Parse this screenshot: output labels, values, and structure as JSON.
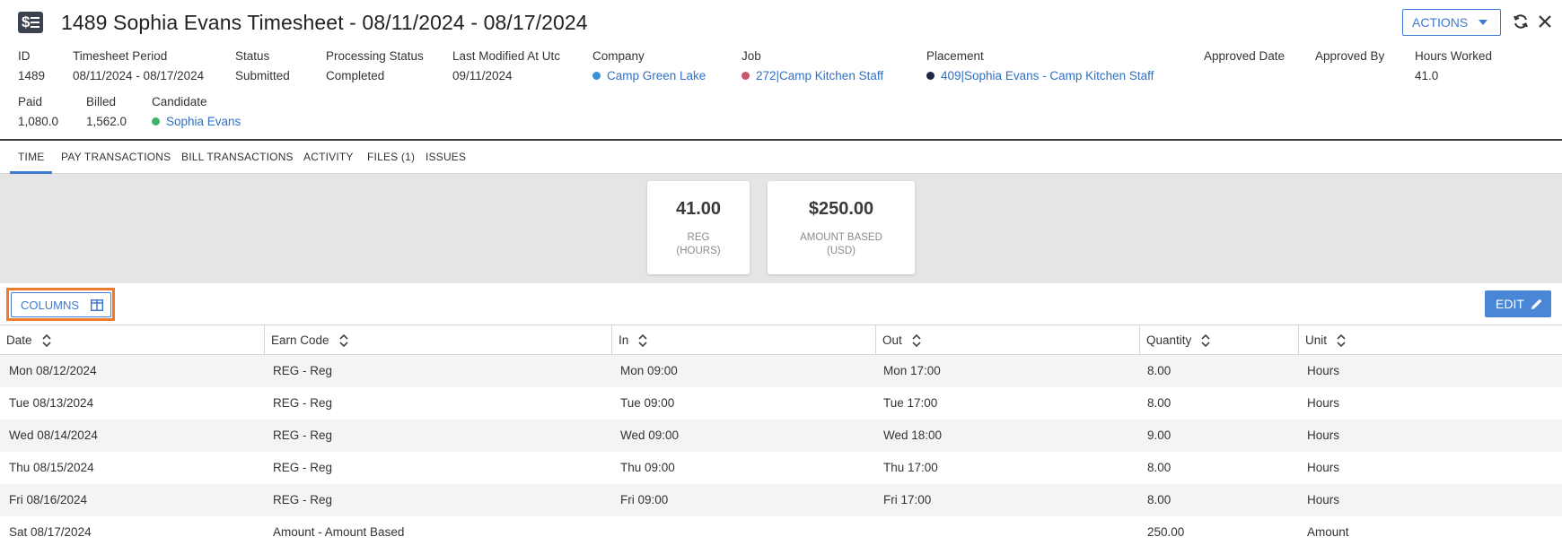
{
  "header": {
    "title": "1489  Sophia Evans Timesheet - 08/11/2024 - 08/17/2024",
    "actions_label": "ACTIONS",
    "fields": {
      "id": {
        "label": "ID",
        "value": "1489"
      },
      "period": {
        "label": "Timesheet Period",
        "value": "08/11/2024 - 08/17/2024"
      },
      "status": {
        "label": "Status",
        "value": "Submitted"
      },
      "processing": {
        "label": "Processing Status",
        "value": "Completed"
      },
      "modified": {
        "label": "Last Modified At Utc",
        "value": "09/11/2024"
      },
      "company": {
        "label": "Company",
        "value": "Camp Green Lake",
        "dot_color": "#3b8fd6"
      },
      "job": {
        "label": "Job",
        "value": "272|Camp Kitchen Staff",
        "dot_color": "#c75a6a"
      },
      "placement": {
        "label": "Placement",
        "value": "409|Sophia Evans - Camp Kitchen Staff",
        "dot_color": "#1e2a44"
      },
      "approved_date": {
        "label": "Approved Date",
        "value": ""
      },
      "approved_by": {
        "label": "Approved By",
        "value": ""
      },
      "hours_worked": {
        "label": "Hours Worked",
        "value": "41.0"
      },
      "paid": {
        "label": "Paid",
        "value": "1,080.0"
      },
      "billed": {
        "label": "Billed",
        "value": "1,562.0"
      },
      "candidate": {
        "label": "Candidate",
        "value": "Sophia Evans",
        "dot_color": "#3fb56a"
      }
    }
  },
  "tabs": [
    "TIME",
    "PAY TRANSACTIONS",
    "BILL TRANSACTIONS",
    "ACTIVITY",
    "FILES (1)",
    "ISSUES"
  ],
  "summary": [
    {
      "value": "41.00",
      "label_line1": "REG",
      "label_line2": "(HOURS)"
    },
    {
      "value": "$250.00",
      "label_line1": "AMOUNT BASED",
      "label_line2": "(USD)"
    }
  ],
  "toolbar": {
    "columns_label": "COLUMNS",
    "edit_label": "EDIT"
  },
  "table": {
    "headers": [
      "Date",
      "Earn Code",
      "In",
      "Out",
      "Quantity",
      "Unit"
    ],
    "rows": [
      [
        "Mon 08/12/2024",
        "REG - Reg",
        "Mon 09:00",
        "Mon 17:00",
        "8.00",
        "Hours"
      ],
      [
        "Tue 08/13/2024",
        "REG - Reg",
        "Tue 09:00",
        "Tue 17:00",
        "8.00",
        "Hours"
      ],
      [
        "Wed 08/14/2024",
        "REG - Reg",
        "Wed 09:00",
        "Wed 18:00",
        "9.00",
        "Hours"
      ],
      [
        "Thu 08/15/2024",
        "REG - Reg",
        "Thu 09:00",
        "Thu 17:00",
        "8.00",
        "Hours"
      ],
      [
        "Fri 08/16/2024",
        "REG - Reg",
        "Fri 09:00",
        "Fri 17:00",
        "8.00",
        "Hours"
      ],
      [
        "Sat 08/17/2024",
        "Amount - Amount Based",
        "",
        "",
        "250.00",
        "Amount"
      ]
    ]
  },
  "colors": {
    "accent": "#3f7ad1",
    "highlight": "#f07a2c"
  }
}
